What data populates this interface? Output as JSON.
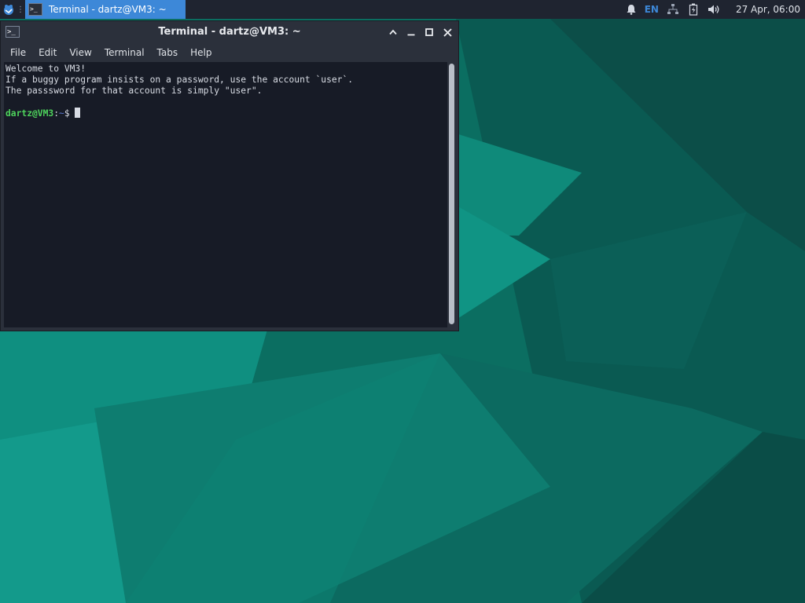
{
  "panel": {
    "menu_icon": "whisker-menu-icon",
    "task": {
      "icon": "terminal-icon",
      "label": "Terminal - dartz@VM3: ~"
    },
    "tray": {
      "notification_icon": "bell-icon",
      "keyboard_layout": "EN",
      "network_icon": "network-icon",
      "battery_icon": "battery-icon",
      "volume_icon": "speaker-icon"
    },
    "clock": "27 Apr, 06:00"
  },
  "window": {
    "title": "Terminal - dartz@VM3: ~",
    "icon": "terminal-icon",
    "controls": {
      "maximize_up": "chevron-up-icon",
      "minimize": "minimize-icon",
      "maximize": "maximize-icon",
      "close": "close-icon"
    },
    "menu": [
      "File",
      "Edit",
      "View",
      "Terminal",
      "Tabs",
      "Help"
    ],
    "output": [
      "Welcome to VM3!",
      "If a buggy program insists on a password, use the account `user`.",
      "The passsword for that account is simply \"user\"."
    ],
    "prompt": {
      "user_host": "dartz@VM3",
      "sep": ":",
      "path": "~",
      "symbol": "$ "
    }
  },
  "colors": {
    "accent": "#3d88d8",
    "prompt_green": "#4ed35c",
    "terminal_bg": "#171b26",
    "wallpaper": "#0d6b5e"
  }
}
